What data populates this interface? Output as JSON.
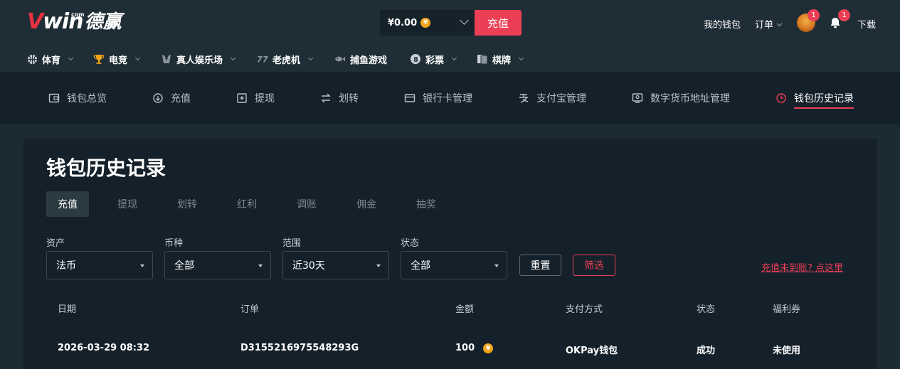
{
  "header": {
    "logo": {
      "v": "V",
      "win": "win",
      "com": "com",
      "cn": "德赢"
    },
    "balance": "¥0.00",
    "coin_symbol": "¥",
    "recharge_label": "充值",
    "wallet_label": "我的钱包",
    "orders_label": "订单",
    "avatar_badge": "1",
    "notify_badge": "1",
    "download_label": "下载"
  },
  "nav": {
    "items": [
      {
        "label": "体育",
        "icon": "basketball-icon"
      },
      {
        "label": "电竞",
        "icon": "trophy-icon"
      },
      {
        "label": "真人娱乐场",
        "icon": "dealer-icon"
      },
      {
        "label": "老虎机",
        "icon": "slot-icon"
      },
      {
        "label": "捕鱼游戏",
        "icon": "fish-icon"
      },
      {
        "label": "彩票",
        "icon": "lottery-ball-icon"
      },
      {
        "label": "棋牌",
        "icon": "cards-icon"
      }
    ]
  },
  "subnav": {
    "items": [
      {
        "label": "钱包总览",
        "icon": "wallet-icon"
      },
      {
        "label": "充值",
        "icon": "deposit-icon"
      },
      {
        "label": "提现",
        "icon": "withdraw-icon"
      },
      {
        "label": "划转",
        "icon": "transfer-icon"
      },
      {
        "label": "银行卡管理",
        "icon": "bank-card-icon"
      },
      {
        "label": "支付宝管理",
        "icon": "alipay-icon"
      },
      {
        "label": "数字货币地址管理",
        "icon": "crypto-address-icon"
      },
      {
        "label": "钱包历史记录",
        "icon": "history-clock-icon",
        "active": true
      }
    ]
  },
  "page": {
    "title": "钱包历史记录",
    "tabs": [
      "充值",
      "提现",
      "划转",
      "红利",
      "调账",
      "佣金",
      "抽奖"
    ],
    "active_tab": "充值"
  },
  "filters": {
    "asset": {
      "label": "资产",
      "value": "法币"
    },
    "currency": {
      "label": "币种",
      "value": "全部"
    },
    "range": {
      "label": "范围",
      "value": "近30天"
    },
    "status": {
      "label": "状态",
      "value": "全部"
    },
    "reset_label": "重置",
    "filter_label": "筛选",
    "help_link": "充值未到账? 点这里"
  },
  "table": {
    "headers": {
      "date": "日期",
      "order": "订单",
      "amount": "金额",
      "method": "支付方式",
      "status": "状态",
      "coupon": "福利券"
    },
    "rows": [
      {
        "date": "2026-03-29 08:32",
        "order": "D3155216975548293G",
        "amount": "100",
        "method": "OKPay钱包",
        "status": "成功",
        "coupon": "未使用"
      }
    ]
  },
  "colors": {
    "accent": "#ec3f55",
    "coin": "#f2a51a",
    "bg": "#1c2a33",
    "panel": "#15212a"
  }
}
